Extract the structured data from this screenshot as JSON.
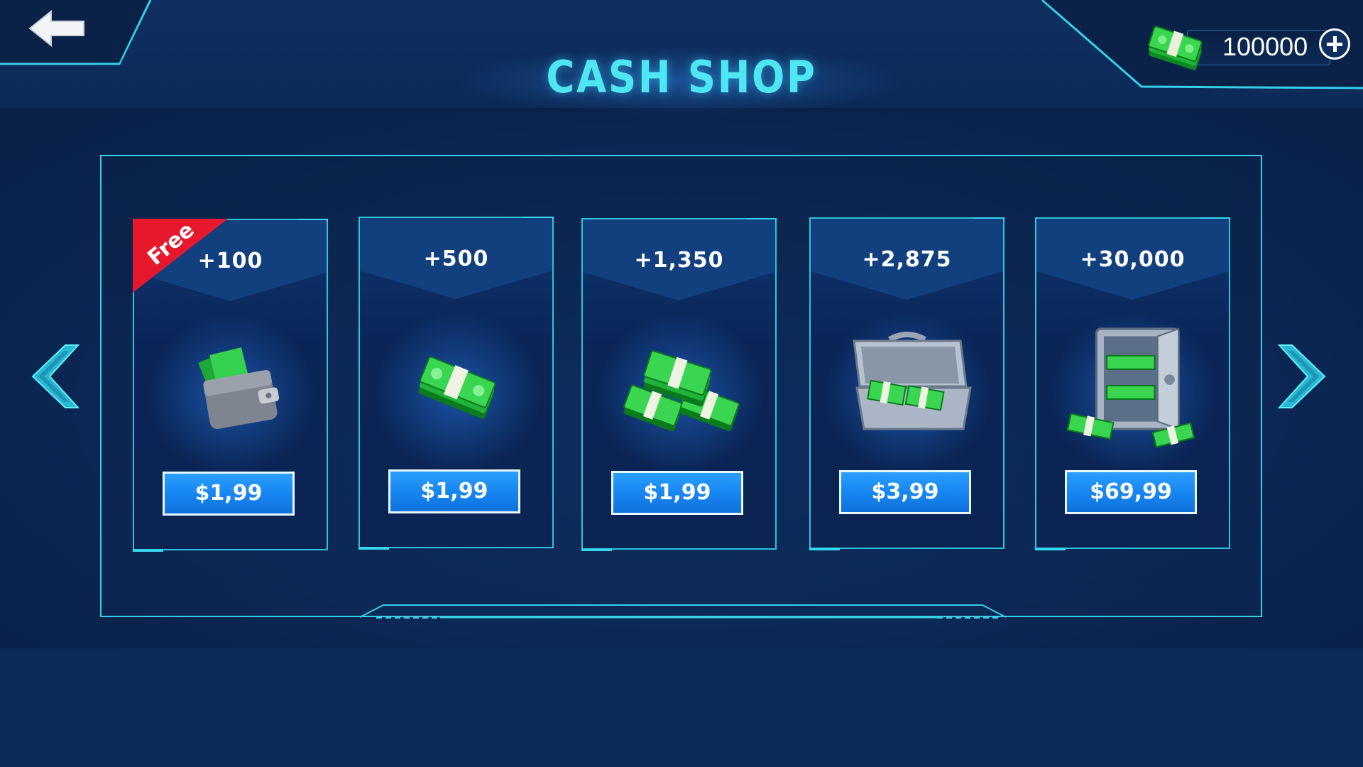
{
  "header": {
    "title": "CASH SHOP",
    "back_icon": "arrow-left-icon",
    "currency": {
      "icon": "cash-stack-icon",
      "value": "100000",
      "add_icon": "plus-icon"
    }
  },
  "navigation": {
    "prev_icon": "chevron-left-icon",
    "next_icon": "chevron-right-icon"
  },
  "offers": [
    {
      "amount": "+100",
      "price": "$1,99",
      "badge": "Free",
      "icon": "wallet-cash-icon"
    },
    {
      "amount": "+500",
      "price": "$1,99",
      "icon": "cash-stack-icon"
    },
    {
      "amount": "+1,350",
      "price": "$1,99",
      "icon": "cash-pile-icon"
    },
    {
      "amount": "+2,875",
      "price": "$3,99",
      "icon": "cash-briefcase-icon"
    },
    {
      "amount": "+30,000",
      "price": "$69,99",
      "icon": "cash-safe-icon"
    }
  ],
  "colors": {
    "accent": "#35cfe6",
    "title": "#4ee6f2",
    "button": "#1684f0",
    "ribbon": "#e8182c",
    "background": "#0b2750"
  }
}
